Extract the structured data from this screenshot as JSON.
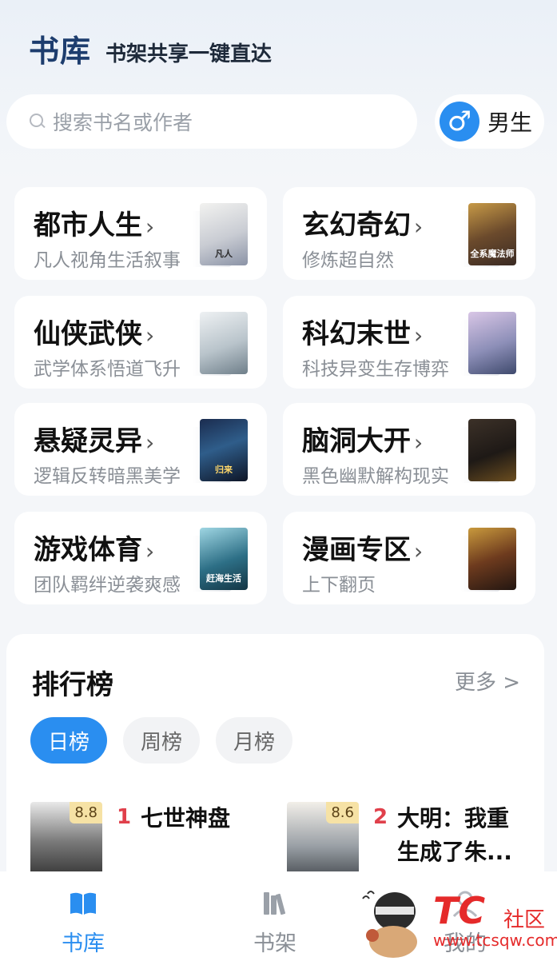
{
  "header": {
    "brand": "书库",
    "slogan": "书架共享一键直达"
  },
  "search": {
    "placeholder": "搜索书名或作者"
  },
  "gender": {
    "symbol": "♂",
    "label": "男生"
  },
  "categories": [
    {
      "title": "都市人生",
      "sub": "凡人视角生活叙事",
      "cover_text": "凡人"
    },
    {
      "title": "玄幻奇幻",
      "sub": "修炼超自然",
      "cover_text": "全系魔法师"
    },
    {
      "title": "仙侠武侠",
      "sub": "武学体系悟道飞升",
      "cover_text": ""
    },
    {
      "title": "科幻末世",
      "sub": "科技异变生存博弈",
      "cover_text": ""
    },
    {
      "title": "悬疑灵异",
      "sub": "逻辑反转暗黑美学",
      "cover_text": "归来"
    },
    {
      "title": "脑洞大开",
      "sub": "黑色幽默解构现实",
      "cover_text": ""
    },
    {
      "title": "游戏体育",
      "sub": "团队羁绊逆袭爽感",
      "cover_text": "赶海生活"
    },
    {
      "title": "漫画专区",
      "sub": "上下翻页",
      "cover_text": ""
    }
  ],
  "ranking": {
    "title": "排行榜",
    "more": "更多 >",
    "tabs": [
      "日榜",
      "周榜",
      "月榜"
    ],
    "items": [
      {
        "rank": "1",
        "name": "七世神盘",
        "score": "8.8"
      },
      {
        "rank": "2",
        "name": "大明：我重生成了朱...",
        "score": "8.6"
      }
    ]
  },
  "tabbar": {
    "items": [
      "书库",
      "书架",
      "我的"
    ]
  },
  "watermark": {
    "logo": "TC",
    "label": "社区",
    "url": "www.tcsqw.com"
  },
  "colors": {
    "accent": "#2a8ef0",
    "brand": "#1d3d6e",
    "rank_red": "#e0404b"
  }
}
